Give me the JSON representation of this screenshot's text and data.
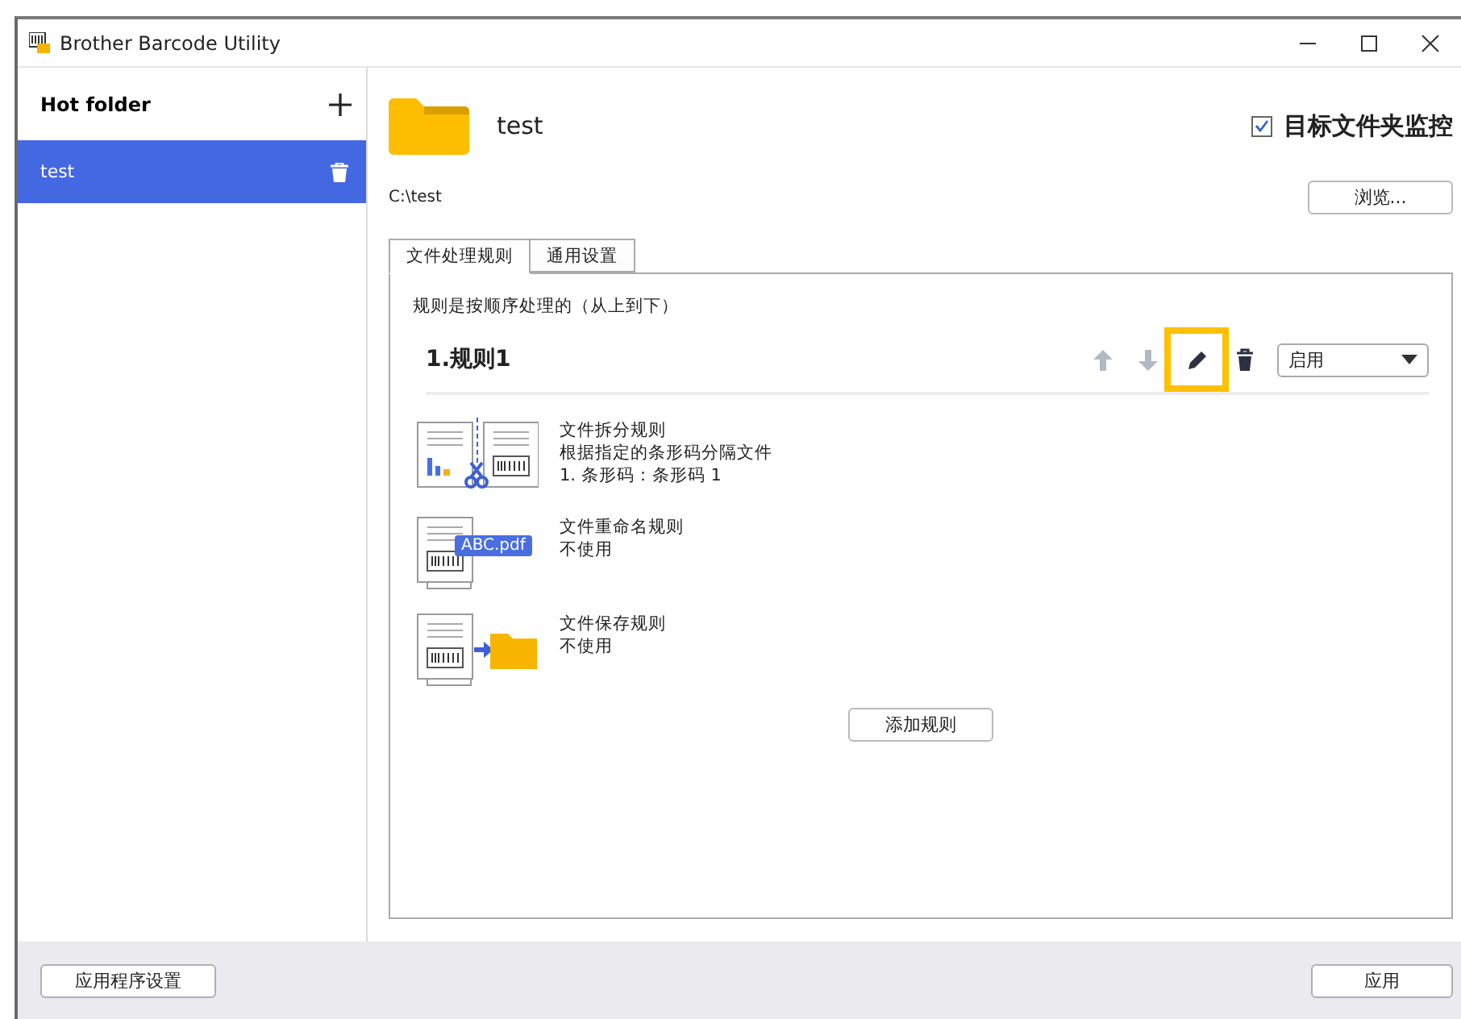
{
  "window": {
    "title": "Brother Barcode Utility"
  },
  "sidebar": {
    "heading": "Hot folder",
    "items": [
      {
        "label": "test",
        "selected": true
      }
    ]
  },
  "folder": {
    "name": "test",
    "path": "C:\\test",
    "monitor": {
      "label": "目标文件夹监控",
      "checked": true
    },
    "browse_button": "浏览..."
  },
  "tabs": [
    {
      "label": "文件处理规则",
      "selected": true
    },
    {
      "label": "通用设置",
      "selected": false
    }
  ],
  "note": "规则是按顺序处理的（从上到下）",
  "rule": {
    "title": "1.规则1",
    "actions": [
      {
        "kind": "up",
        "disabled": true,
        "highlighted": false
      },
      {
        "kind": "down",
        "disabled": true,
        "highlighted": false
      },
      {
        "kind": "edit",
        "disabled": false,
        "highlighted": true
      },
      {
        "kind": "delete",
        "disabled": false,
        "highlighted": false
      }
    ],
    "status": "启用",
    "steps": [
      {
        "kind": "split",
        "title": "文件拆分规则",
        "lines": [
          "根据指定的条形码分隔文件",
          "1. 条形码：条形码 1"
        ]
      },
      {
        "kind": "rename",
        "badge": "ABC.pdf",
        "title": "文件重命名规则",
        "lines": [
          "不使用"
        ]
      },
      {
        "kind": "save",
        "title": "文件保存规则",
        "lines": [
          "不使用"
        ]
      }
    ]
  },
  "add_rule_button": "添加规则",
  "footer": {
    "settings_button": "应用程序设置",
    "apply_button": "应用"
  }
}
